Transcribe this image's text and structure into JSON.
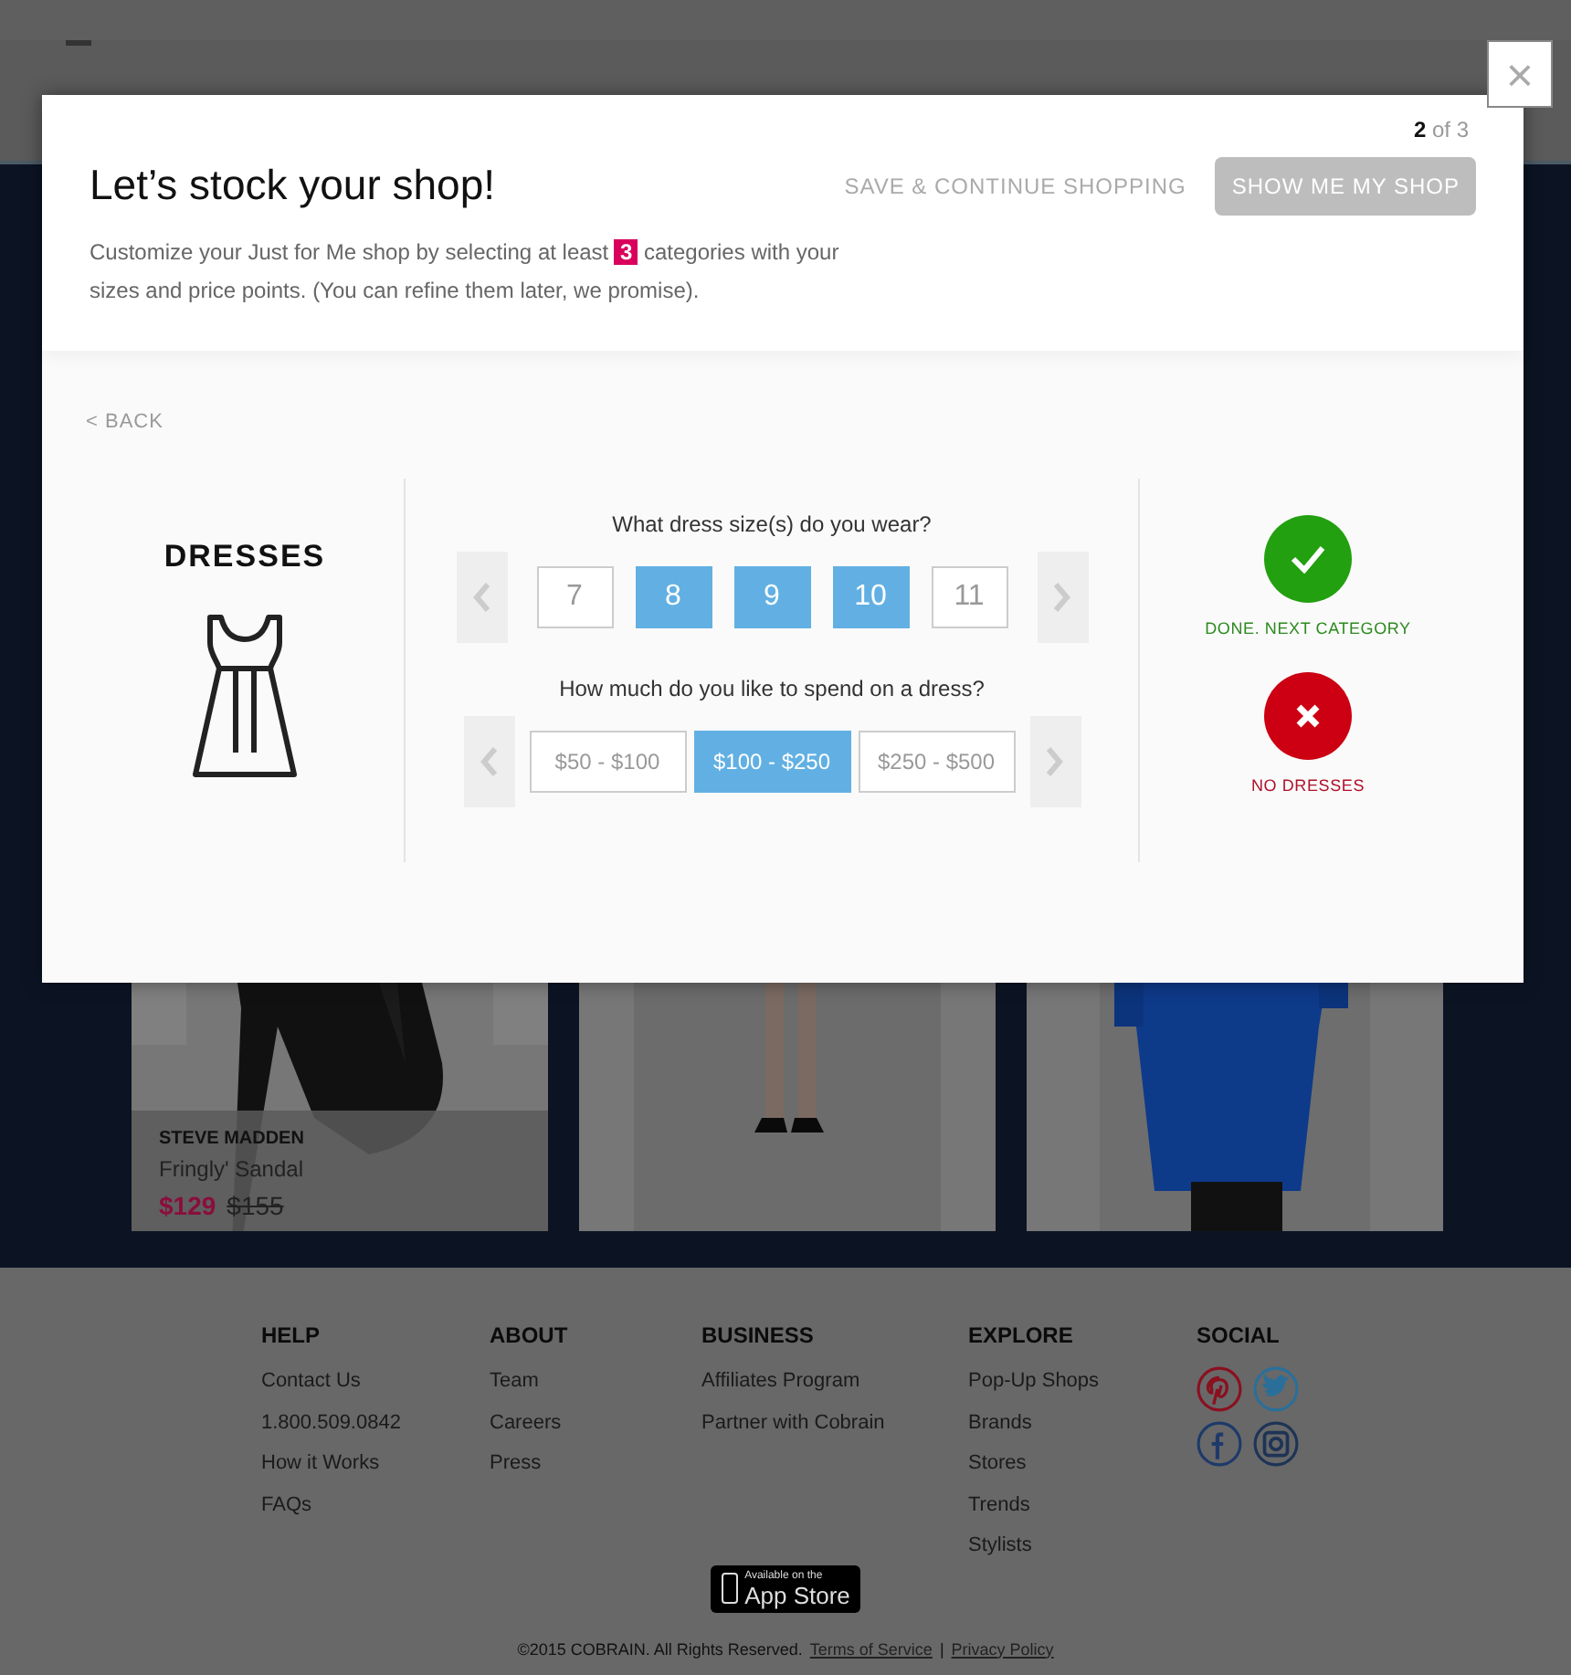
{
  "close_button": "×",
  "modal": {
    "step": "2",
    "step_total": "of 3",
    "title": "Let’s stock your shop!",
    "save_link": "SAVE & CONTINUE SHOPPING",
    "show_button": {
      "label": "SHOW ME MY SHOP",
      "disabled": true
    },
    "intro": {
      "before": "Customize your Just for Me shop by selecting at least",
      "highlight": "3",
      "after": "categories with your sizes and price points. (You can refine them later, we promise)."
    },
    "back_link": "< BACK",
    "category": "DRESSES",
    "size_question": "What dress size(s) do you wear?",
    "sizes": [
      {
        "label": "7",
        "selected": false
      },
      {
        "label": "8",
        "selected": true
      },
      {
        "label": "9",
        "selected": true
      },
      {
        "label": "10",
        "selected": true
      },
      {
        "label": "11",
        "selected": false
      }
    ],
    "price_question": "How much do you like to spend on a dress?",
    "prices": [
      {
        "label": "$50 - $100",
        "selected": false
      },
      {
        "label": "$100 - $250",
        "selected": true
      },
      {
        "label": "$250 - $500",
        "selected": false
      }
    ],
    "done_label": "DONE. NEXT CATEGORY",
    "skip_label": "NO DRESSES"
  },
  "products": [
    {
      "kind": "picture",
      "brand": "STEVE MADDEN",
      "name": "Fringly' Sandal",
      "price": "$129",
      "old_price": "$155"
    },
    {
      "kind": "picture"
    },
    {
      "kind": "picture"
    }
  ],
  "footer": {
    "columns": [
      {
        "heading": "HELP",
        "links": [
          "Contact Us",
          "1.800.509.0842",
          "How it Works",
          "FAQs"
        ]
      },
      {
        "heading": "ABOUT",
        "links": [
          "Team",
          "Careers",
          "Press"
        ]
      },
      {
        "heading": "BUSINESS",
        "links": [
          "Affiliates Program",
          "Partner with Cobrain"
        ]
      },
      {
        "heading": "EXPLORE",
        "links": [
          "Pop-Up Shops",
          "Brands",
          "Stores",
          "Trends",
          "Stylists"
        ]
      }
    ],
    "social_heading": "SOCIAL",
    "app_store": {
      "small": "Available on the",
      "big": "App Store"
    },
    "copyright": "©2015 COBRAIN. All Rights Reserved.",
    "terms": "Terms of Service",
    "separator": "|",
    "privacy": "Privacy Policy"
  }
}
